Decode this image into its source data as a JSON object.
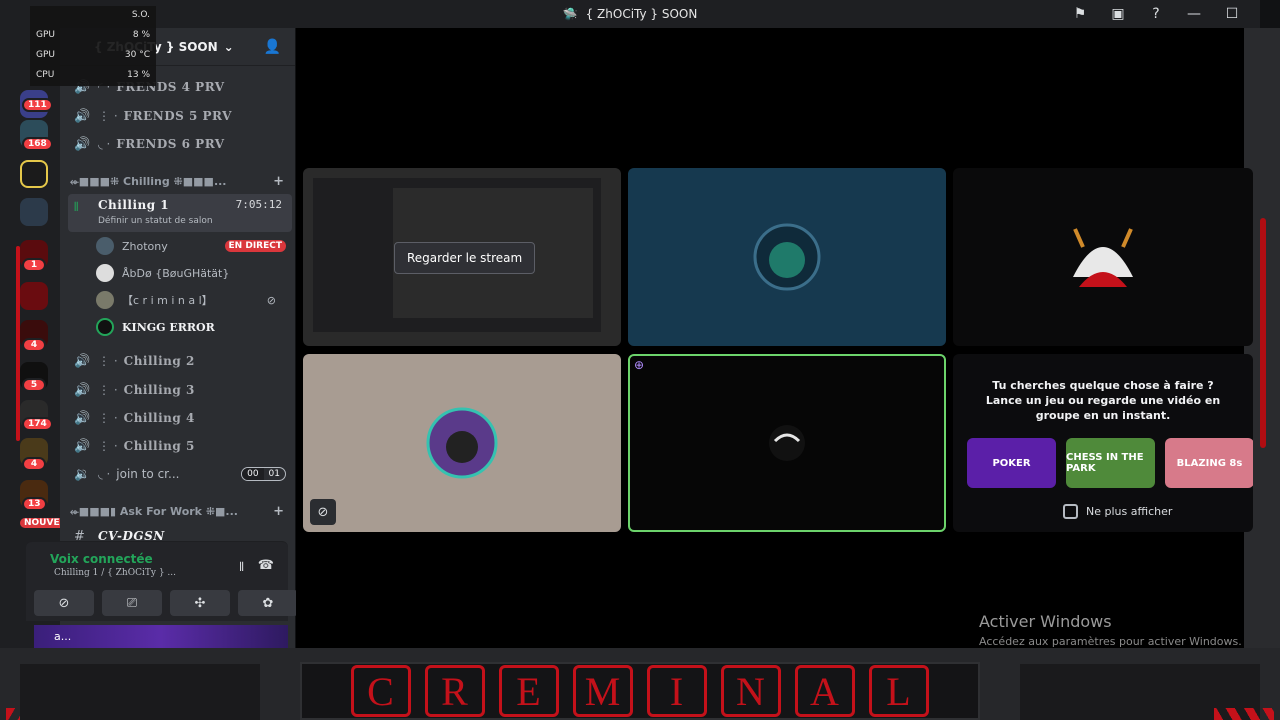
{
  "window": {
    "title": "{ ZhOCiTy } SOON"
  },
  "titlebar_icons": [
    "flag-icon",
    "inbox-icon",
    "help-icon",
    "minimize-icon",
    "maximize-icon"
  ],
  "stats": {
    "cpu_label": "CPU",
    "gpu_label": "GPU",
    "gpu2_label": "GPU",
    "so": "S.O.",
    "gpu_pct": "8 %",
    "gpu_temp": "30 °C",
    "cpu_pct": "13 %"
  },
  "server": {
    "name": "{ ZhOCiTy } SOON"
  },
  "rail_badges": [
    "111",
    "168",
    "1",
    "4",
    "5",
    "174",
    "4",
    "13"
  ],
  "rail_labels": {
    "nouveau": "NOUVEAU"
  },
  "channels_top": [
    {
      "label": "FRENDS 4 PRV"
    },
    {
      "label": "FRENDS 5 PRV"
    },
    {
      "label": "FRENDS 6 PRV"
    }
  ],
  "category_chilling": "⬰■■■⁜ Chilling ⁜■■■...",
  "active_channel": {
    "label": "Chilling 1",
    "time": "7:05:12",
    "status": "Définir un statut de salon"
  },
  "users": [
    {
      "name": "Zhotony",
      "live": "EN DIRECT"
    },
    {
      "name": "ÅbDø {BøuGHätät}"
    },
    {
      "name": "【c r i m i n a l】"
    },
    {
      "name": "KINGG ERROR"
    }
  ],
  "channels_chilling": [
    {
      "label": "Chilling 2"
    },
    {
      "label": "Chilling 3"
    },
    {
      "label": "Chilling 4"
    },
    {
      "label": "Chilling 5"
    },
    {
      "label": "join to cr..."
    }
  ],
  "join_counter": [
    "00",
    "01"
  ],
  "category_work": "⬰■■■▮ Ask For Work ⁜■...",
  "channel_cv": "CV-DGSN",
  "voice": {
    "title": "Voix connectée",
    "sub": "Chilling 1 / { ZhOCiTy } ..."
  },
  "userbar": {
    "text": "a..."
  },
  "stage": {
    "watch_button": "Regarder le stream",
    "activity_msg_1": "Tu cherches quelque chose à faire ?",
    "activity_msg_2": "Lance un jeu ou regarde une vidéo en groupe en un instant.",
    "games": [
      "POKER",
      "CHESS IN THE PARK",
      "BLAZING 8s"
    ],
    "no_show": "Ne plus afficher"
  },
  "windows_activation": {
    "title": "Activer Windows",
    "sub": "Accédez aux paramètres pour activer Windows."
  },
  "banner_letters": [
    "C",
    "R",
    "E",
    "M",
    "I",
    "N",
    "A",
    "L"
  ],
  "colors": {
    "accent_red": "#c4111a",
    "voice_green": "#23a55a",
    "live_red": "#da373c"
  }
}
